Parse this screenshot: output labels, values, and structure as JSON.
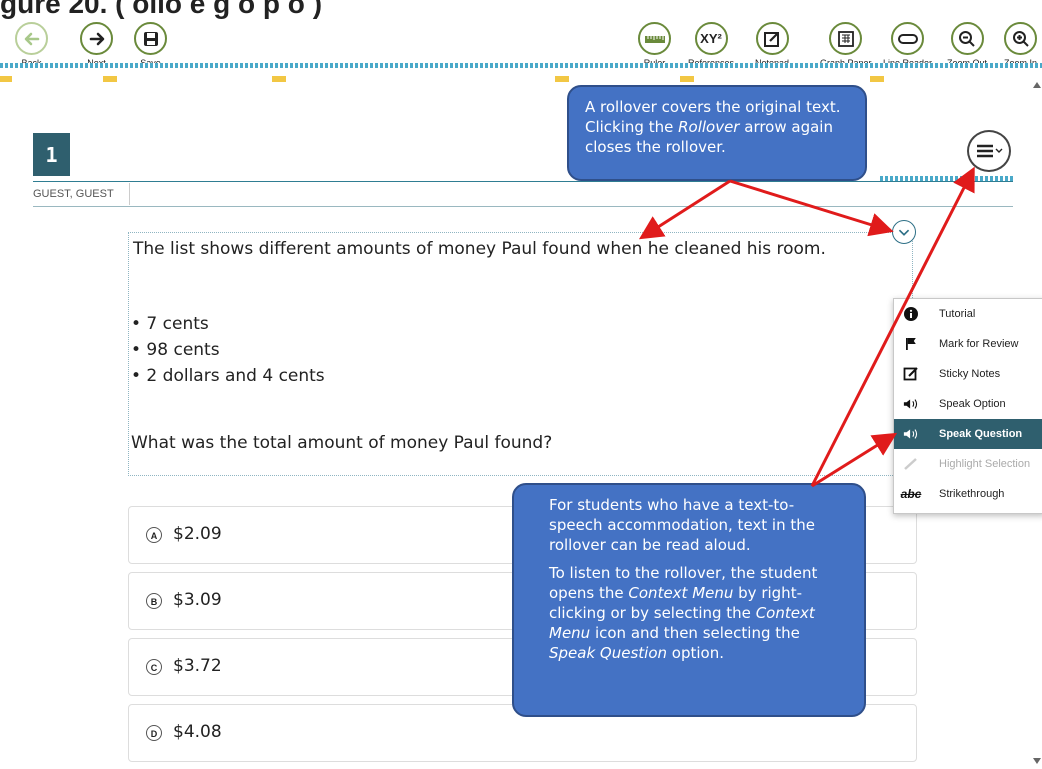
{
  "heading": "gure 20.  ( ollo   e   g   o  p o  )",
  "toolbar": {
    "left": [
      {
        "label": "Back",
        "icon": "back-arrow-icon"
      },
      {
        "label": "Next",
        "icon": "next-arrow-icon"
      },
      {
        "label": "Save",
        "icon": "save-icon"
      }
    ],
    "right": [
      {
        "label": "Ruler",
        "icon": "ruler-icon"
      },
      {
        "label": "References",
        "icon": "references-icon",
        "glyph": "XY²"
      },
      {
        "label": "Notepad",
        "icon": "notepad-icon"
      },
      {
        "label": "Graph Paper",
        "icon": "graph-paper-icon"
      },
      {
        "label": "Line Reader",
        "icon": "line-reader-icon"
      },
      {
        "label": "Zoom Out",
        "icon": "zoom-out-icon"
      },
      {
        "label": "Zoom In",
        "icon": "zoom-in-icon"
      }
    ]
  },
  "question": {
    "number": "1",
    "student": "GUEST, GUEST",
    "passage_intro": "The list shows different amounts of money Paul found when he cleaned his room.",
    "items": [
      "• 7 cents",
      "• 98 cents",
      "• 2 dollars and 4 cents"
    ],
    "prompt": "What was the total amount of money Paul found?"
  },
  "options": [
    {
      "letter": "A",
      "value": "$2.09"
    },
    {
      "letter": "B",
      "value": "$3.09"
    },
    {
      "letter": "C",
      "value": "$3.72"
    },
    {
      "letter": "D",
      "value": "$4.08"
    }
  ],
  "context_menu": [
    {
      "label": "Tutorial",
      "icon": "info-icon",
      "state": "normal"
    },
    {
      "label": "Mark for Review",
      "icon": "flag-icon",
      "state": "normal"
    },
    {
      "label": "Sticky Notes",
      "icon": "sticky-note-icon",
      "state": "normal"
    },
    {
      "label": "Speak Option",
      "icon": "speaker-icon",
      "state": "normal"
    },
    {
      "label": "Speak Question",
      "icon": "speaker-icon",
      "state": "active"
    },
    {
      "label": "Highlight Selection",
      "icon": "highlighter-icon",
      "state": "disabled"
    },
    {
      "label": "Strikethrough",
      "icon": "strikethrough-icon",
      "state": "normal",
      "glyph": "abc"
    }
  ],
  "callouts": {
    "top_pre": "A rollover covers the original text. Clicking the ",
    "top_em": "Rollover",
    "top_post": " arrow again closes the rollover.",
    "bottom_p1": "For students who have a text-to-speech accommodation, text in the rollover can be read aloud.",
    "bottom_p2_a": "To listen to the rollover, the student opens the ",
    "bottom_p2_em1": "Context Menu",
    "bottom_p2_b": " by right-clicking or by selecting the ",
    "bottom_p2_em2": "Context Menu",
    "bottom_p2_c": " icon and then selecting the ",
    "bottom_p2_em3": "Speak Question",
    "bottom_p2_d": " option."
  },
  "colors": {
    "tool_ring": "#6a8a3b",
    "header_teal": "#2f5f6e",
    "callout_blue": "#4472c4",
    "arrow_red": "#e01b1b"
  }
}
